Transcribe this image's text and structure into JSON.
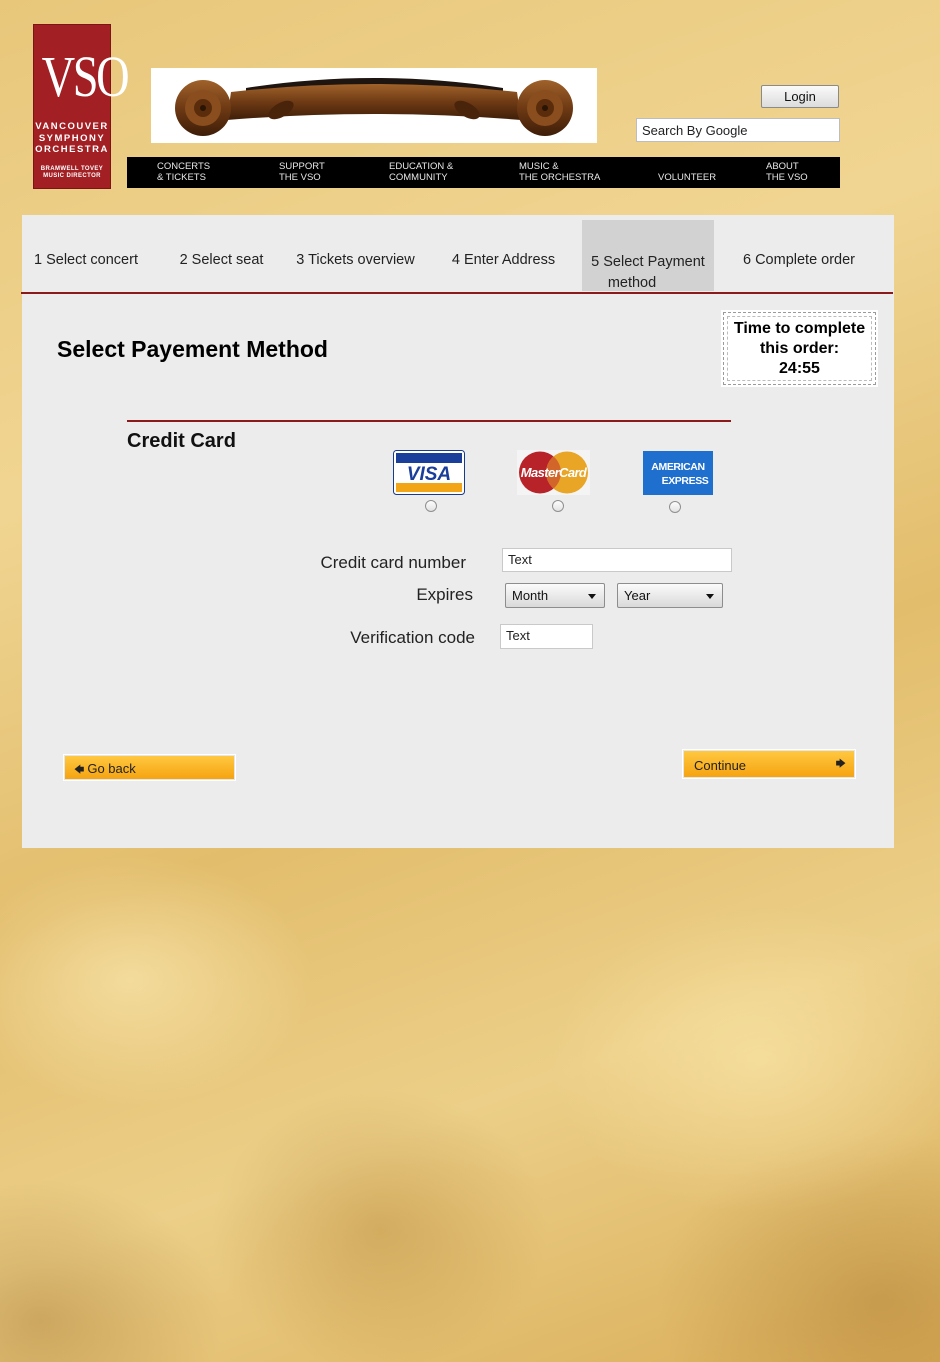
{
  "header": {
    "logo": {
      "big": "VSO",
      "lines": [
        "VANCOUVER",
        "SYMPHONY",
        "ORCHESTRA"
      ],
      "small": [
        "BRAMWELL TOVEY",
        "MUSIC DIRECTOR"
      ]
    },
    "login_label": "Login",
    "search_value": "Search By Google",
    "nav": [
      {
        "line1": "Concerts",
        "line2": "& Tickets"
      },
      {
        "line1": "Support",
        "line2": "The VSO"
      },
      {
        "line1": "Education &",
        "line2": "Community"
      },
      {
        "line1": "Music &",
        "line2": "The Orchestra"
      },
      {
        "line1": "",
        "line2": "Volunteer"
      },
      {
        "line1": "About",
        "line2": "The VSO"
      }
    ]
  },
  "steps": [
    {
      "line1": "1 Select concert",
      "line2": ""
    },
    {
      "line1": "2 Select seat",
      "line2": ""
    },
    {
      "line1": "3 Tickets overview",
      "line2": ""
    },
    {
      "line1": "4 Enter Address",
      "line2": ""
    },
    {
      "line1": "5 Select Payment",
      "line2": "method"
    },
    {
      "line1": "6 Complete order",
      "line2": ""
    }
  ],
  "active_step": 5,
  "page_title": "Select Payement Method",
  "timer": {
    "line1": "Time to complete",
    "line2": "this order:",
    "value": "24:55"
  },
  "payment": {
    "section_title": "Credit Card",
    "cards": [
      {
        "name": "VISA",
        "icon": "visa-logo"
      },
      {
        "name": "MasterCard",
        "icon": "mastercard-logo"
      },
      {
        "name": "AMERICAN EXPRESS",
        "icon": "amex-logo"
      }
    ],
    "card_number_label": "Credit card number",
    "card_number_value": "Text",
    "expires_label": "Expires",
    "month_value": "Month",
    "year_value": "Year",
    "verification_label": "Verification code",
    "verification_value": "Text"
  },
  "actions": {
    "back_label": "Go back",
    "continue_label": "Continue"
  },
  "colors": {
    "brand_red": "#a21f24",
    "divider_red": "#8b1a1a",
    "button_orange": "#f5a311"
  }
}
